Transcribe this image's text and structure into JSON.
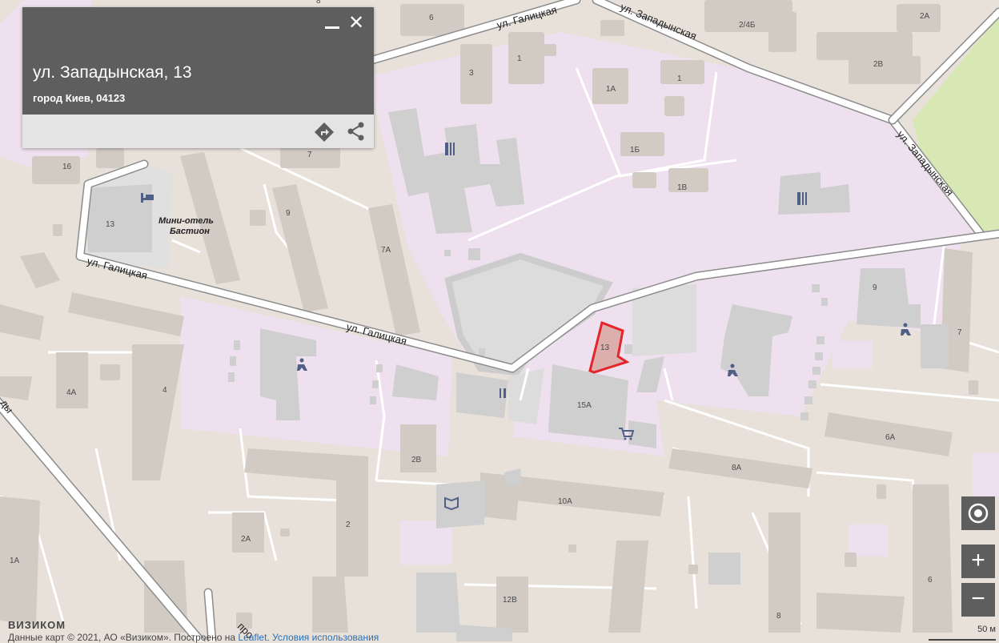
{
  "popup": {
    "title": "ул. Западынская, 13",
    "subtitle": "город Киев, 04123",
    "minimize_icon": "minimize-icon",
    "close_label": "✕",
    "route_icon": "route-icon",
    "share_icon": "share-icon"
  },
  "map": {
    "streets": {
      "galitskaya_1": "ул. Галицкая",
      "galitskaya_2": "ул. Галицкая",
      "galitskaya_3": "ул. Галицкая",
      "zapadynskaya_1": "ул. Западынская",
      "zapadynskaya_2": "ул. Западынская",
      "partial_left": "ды",
      "partial_bottom": "про"
    },
    "poi": {
      "hotel_line1": "Мини-отель",
      "hotel_line2": "Бастион"
    },
    "houses": {
      "h6": "6",
      "h3": "3",
      "h1a": "1",
      "h1b": "1",
      "h1A": "1А",
      "h1B": "1Б",
      "h1V": "1В",
      "h2_4b": "2/4Б",
      "h2A_top": "2А",
      "h2V_top": "2В",
      "h16": "16",
      "h7_top": "7",
      "h13_left": "13",
      "h9_left": "9",
      "h7A": "7А",
      "h9_right": "9",
      "h7_right": "7",
      "h13_target": "13",
      "h15A": "15А",
      "h4A": "4А",
      "h4": "4",
      "h2V": "2В",
      "h6A": "6А",
      "h8A": "8А",
      "h10A": "10А",
      "h2": "2",
      "h2A": "2А",
      "h1A_bottom": "1А",
      "h12V": "12В",
      "h6_bottom": "6",
      "h8_bottom": "8",
      "h8_top": "8"
    },
    "colors": {
      "land": "#e8e1da",
      "institution": "#eee0ee",
      "building": "#d2cbc4",
      "building_gray": "#cfcfcf",
      "road": "#ffffff",
      "park": "#d7e8b5",
      "highlight": "#e4252b",
      "icon": "#4f5f86"
    }
  },
  "controls": {
    "locate_icon": "locate-icon",
    "zoom_in_label": "+",
    "zoom_out_label": "−",
    "scale_label": "50 м"
  },
  "attribution": {
    "logo": "ВИЗИКОМ",
    "prefix": "Данные карт © 2021, АО «Визиком». Построено на ",
    "leaflet": "Leaflet",
    "terms": "Условия использования"
  }
}
